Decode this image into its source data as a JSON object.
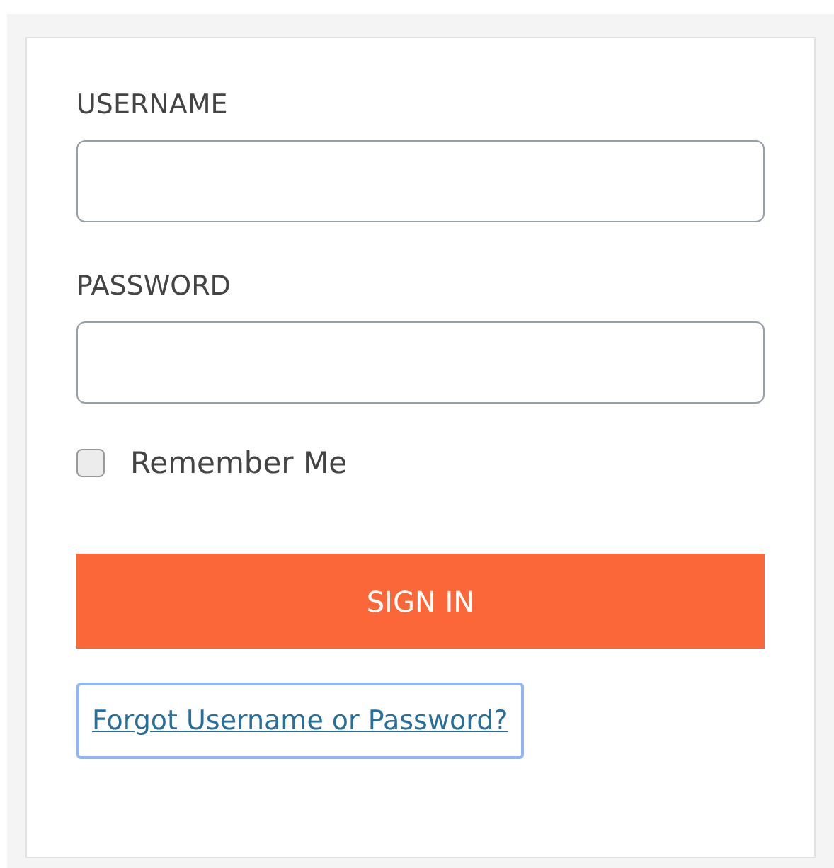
{
  "fields": [
    {
      "label": "USERNAME"
    },
    {
      "label": "PASSWORD"
    }
  ],
  "remember": {
    "label": "Remember Me",
    "checked": false
  },
  "submit": {
    "label": "SIGN IN"
  },
  "forgot_link": {
    "label": "Forgot Username or Password?",
    "focused": true
  }
}
